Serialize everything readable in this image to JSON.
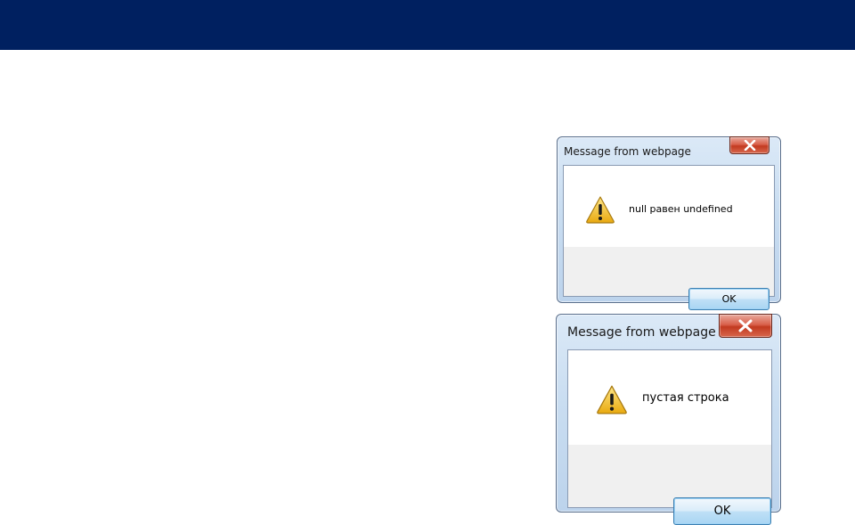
{
  "dialogs": [
    {
      "title": "Message from webpage",
      "message": "null равен undefined",
      "ok_label": "OK",
      "icon": "warning-icon",
      "close_icon": "close-icon"
    },
    {
      "title": "Message from webpage",
      "message": "пустая строка",
      "ok_label": "OK",
      "icon": "warning-icon",
      "close_icon": "close-icon"
    }
  ],
  "colors": {
    "top_bar": "#002060",
    "warning_yellow": "#f2c230",
    "close_red": "#c9452b"
  }
}
